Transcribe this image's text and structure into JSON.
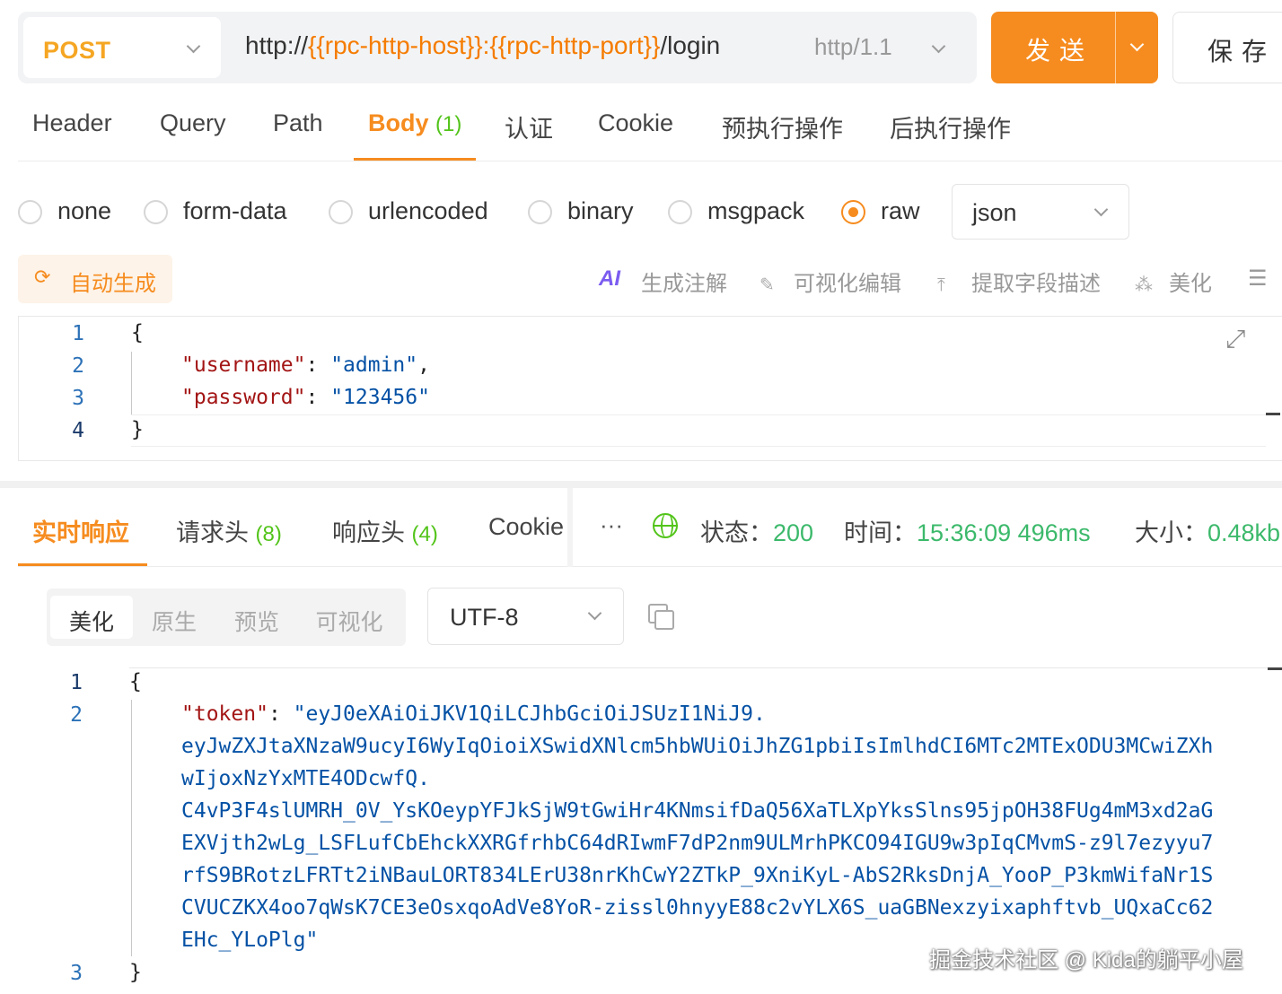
{
  "request": {
    "method": "POST",
    "url_prefix": "http://",
    "url_host_var": "{{rpc-http-host}}",
    "url_sep": ":",
    "url_port_var": "{{rpc-http-port}}",
    "url_path": "/login",
    "protocol": "http/1.1",
    "send_label": "发送",
    "save_label": "保存"
  },
  "request_tabs": [
    {
      "label": "Header"
    },
    {
      "label": "Query"
    },
    {
      "label": "Path"
    },
    {
      "label": "Body",
      "count": "(1)",
      "active": true
    },
    {
      "label": "认证"
    },
    {
      "label": "Cookie"
    },
    {
      "label": "预执行操作"
    },
    {
      "label": "后执行操作"
    }
  ],
  "body_types": [
    {
      "label": "none",
      "checked": false
    },
    {
      "label": "form-data",
      "checked": false
    },
    {
      "label": "urlencoded",
      "checked": false
    },
    {
      "label": "binary",
      "checked": false
    },
    {
      "label": "msgpack",
      "checked": false
    },
    {
      "label": "raw",
      "checked": true
    }
  ],
  "raw_format": "json",
  "toolbar": {
    "autogen_label": "自动生成",
    "ai_icon_text": "AI",
    "gen_comments_label": "生成注解",
    "visual_edit_label": "可视化编辑",
    "extract_desc_label": "提取字段描述",
    "beautify_label": "美化"
  },
  "request_body": {
    "line_numbers": [
      "1",
      "2",
      "3",
      "4"
    ],
    "open_brace": "{",
    "close_brace": "}",
    "fields": [
      {
        "key": "\"username\"",
        "colon": ": ",
        "value": "\"admin\"",
        "trail": ","
      },
      {
        "key": "\"password\"",
        "colon": ": ",
        "value": "\"123456\"",
        "trail": ""
      }
    ]
  },
  "response_tabs": [
    {
      "label": "实时响应",
      "active": true
    },
    {
      "label": "请求头",
      "count": "(8)"
    },
    {
      "label": "响应头",
      "count": "(4)"
    },
    {
      "label": "Cookie"
    }
  ],
  "response_meta": {
    "more": "···",
    "status_label": "状态：",
    "status_value": "200",
    "time_label": "时间：",
    "time_value": "15:36:09",
    "duration_value": "496ms",
    "size_label": "大小：",
    "size_value": "0.48kb"
  },
  "response_view_modes": [
    {
      "label": "美化",
      "active": true
    },
    {
      "label": "原生"
    },
    {
      "label": "预览"
    },
    {
      "label": "可视化"
    }
  ],
  "encoding": "UTF-8",
  "response_body": {
    "line_numbers": [
      "1",
      "2",
      "3"
    ],
    "open_brace": "{",
    "close_brace": "}",
    "token_key": "\"token\"",
    "token_colon": ": ",
    "token_lines": [
      "\"eyJ0eXAiOiJKV1QiLCJhbGciOiJSUzI1NiJ9.",
      "eyJwZXJtaXNzaW9ucyI6WyIqOioiXSwidXNlcm5hbWUiOiJhZG1pbiIsImlhdCI6MTc2MTExODU3MCwiZXh",
      "wIjoxNzYxMTE4ODcwfQ.",
      "C4vP3F4slUMRH_0V_YsKOeypYFJkSjW9tGwiHr4KNmsifDaQ56XaTLXpYksSlns95jpOH38FUg4mM3xd2aG",
      "EXVjth2wLg_LSFLufCbEhckXXRGfrhbC64dRIwmF7dP2nm9ULMrhPKCO94IGU9w3pIqCMvmS-z9l7ezyyu7",
      "rfS9BRotzLFRTt2iNBauLORT834LErU38nrKhCwY2ZTkP_9XniKyL-AbS2RksDnjA_YooP_P3kmWifaNr1S",
      "CVUCZKX4oo7qWsK7CE3eOsxqoAdVe8YoR-zissl0hnyyE88c2vYLX6S_uaGBNexzyixaphftvb_UQxaCc62",
      "EHc_YLoPlg\""
    ]
  },
  "watermark": "掘金技术社区 @ Kida的躺平小屋",
  "colors": {
    "accent": "#f68c1f",
    "method": "#f5a623",
    "count_green": "#52c41a",
    "status_green": "#3cb96b",
    "json_key": "#a31515",
    "json_string": "#0451a5"
  },
  "icons": [
    "chevron-down-icon",
    "refresh-icon",
    "ai-icon",
    "edit-icon",
    "upload-icon",
    "magic-wand-icon",
    "list-icon",
    "expand-icon",
    "more-icon",
    "globe-icon",
    "copy-icon"
  ]
}
